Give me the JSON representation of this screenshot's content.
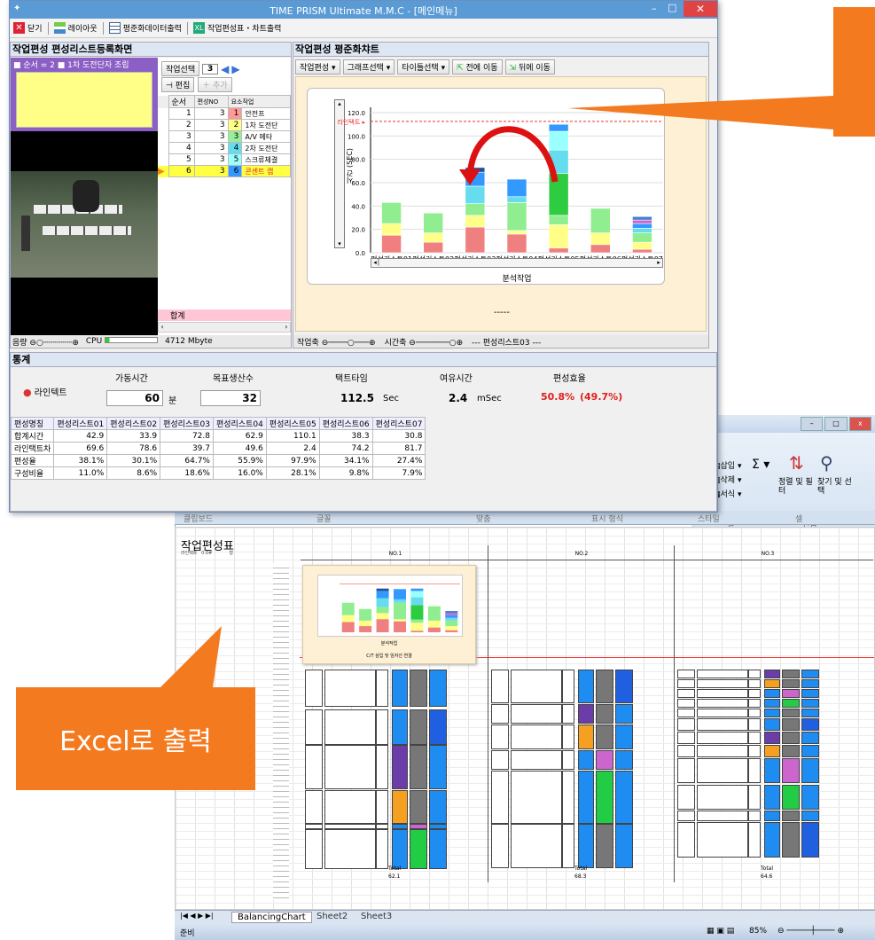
{
  "window": {
    "title": "TIME PRISM Ultimate M.M.C - [메인메뉴]"
  },
  "toolbar": {
    "close": "닫기",
    "layout": "레이아웃",
    "export_data": "평준화데이터출력",
    "export_chart": "작업편성표・차트출력"
  },
  "left_panel": {
    "title": "작업편성 편성리스트등록화면",
    "order_label": "■ 순서 = 2 ■ 1차 도전단자 조립",
    "select_label": "작업선택",
    "select_value": "3",
    "edit_label": "편집",
    "add_label": "추가",
    "table_headers": [
      "순서",
      "편성NO",
      "요소작업"
    ],
    "rows": [
      {
        "order": "1",
        "no": "3",
        "idx": "1",
        "name": "안전프",
        "color": "#ff9999"
      },
      {
        "order": "2",
        "no": "3",
        "idx": "2",
        "name": "1차 도전단",
        "color": "#ffff88"
      },
      {
        "order": "3",
        "no": "3",
        "idx": "3",
        "name": "A/V 메타",
        "color": "#99ee99"
      },
      {
        "order": "4",
        "no": "3",
        "idx": "4",
        "name": "2차 도전단",
        "color": "#66ddee"
      },
      {
        "order": "5",
        "no": "3",
        "idx": "5",
        "name": "스크류체결",
        "color": "#99ffff"
      },
      {
        "order": "6",
        "no": "3",
        "idx": "6",
        "name": "콘센트 캡",
        "color": "#3399ff"
      }
    ],
    "total_label": "합계",
    "volume_label": "음량",
    "cpu_label": "CPU",
    "memory": "4712 Mbyte"
  },
  "chart_panel": {
    "title": "작업편성 평준화챠트",
    "menu": [
      "작업편성",
      "그래프선택",
      "타이틀선택",
      "전에 이동",
      "뒤에 이동"
    ],
    "dashes": "-----",
    "work_axis": "작업축",
    "time_axis": "시간축",
    "list_label": "--- 편성리스트03 ---"
  },
  "stats": {
    "title": "통계",
    "line_tact": "라인텍트",
    "op_time_label": "가동시간",
    "op_time_value": "60",
    "op_time_unit": "분",
    "target_label": "목표생산수",
    "target_value": "32",
    "tact_label": "택트타임",
    "tact_value": "112.5",
    "tact_unit": "Sec",
    "margin_label": "여유시간",
    "margin_value": "2.4",
    "margin_unit": "mSec",
    "eff_label": "편성효율",
    "eff_value": "50.8%",
    "eff_alt": "(49.7%)",
    "table_headers": [
      "편성명칭",
      "편성리스트01",
      "편성리스트02",
      "편성리스트03",
      "편성리스트04",
      "편성리스트05",
      "편성리스트06",
      "편성리스트07"
    ],
    "table_rows": [
      [
        "합계시간",
        "42.9",
        "33.9",
        "72.8",
        "62.9",
        "110.1",
        "38.3",
        "30.8"
      ],
      [
        "라인택트차",
        "69.6",
        "78.6",
        "39.7",
        "49.6",
        "2.4",
        "74.2",
        "81.7"
      ],
      [
        "편성율",
        "38.1%",
        "30.1%",
        "64.7%",
        "55.9%",
        "97.9%",
        "34.1%",
        "27.4%"
      ],
      [
        "구성비율",
        "11.0%",
        "8.6%",
        "18.6%",
        "16.0%",
        "28.1%",
        "9.8%",
        "7.9%"
      ]
    ]
  },
  "chart_data": {
    "type": "bar",
    "stacked": true,
    "ylabel": "시간 (SEC)",
    "xlabel": "분석작업",
    "ylim": [
      0,
      120
    ],
    "yticks": [
      "0.0",
      "20.0",
      "40.0",
      "60.0",
      "80.0",
      "100.0",
      "120.0"
    ],
    "line_tact_label": "라인택트",
    "line_tact_value": 112.5,
    "categories": [
      "편성리스트01",
      "편성리스트02",
      "편성리스트03",
      "편성리스트04",
      "편성리스트05",
      "편성리스트06",
      "편성리스트07"
    ],
    "stacks": [
      [
        {
          "v": 15,
          "c": "#f08080"
        },
        {
          "v": 10,
          "c": "#ffff88"
        },
        {
          "v": 18,
          "c": "#90ee90"
        }
      ],
      [
        {
          "v": 9,
          "c": "#f08080"
        },
        {
          "v": 8,
          "c": "#ffff88"
        },
        {
          "v": 17,
          "c": "#90ee90"
        }
      ],
      [
        {
          "v": 22,
          "c": "#f08080"
        },
        {
          "v": 10,
          "c": "#ffff88"
        },
        {
          "v": 10,
          "c": "#90ee90"
        },
        {
          "v": 15,
          "c": "#66ddee"
        },
        {
          "v": 12,
          "c": "#3399ff"
        },
        {
          "v": 4,
          "c": "#1f4fa0"
        }
      ],
      [
        {
          "v": 16,
          "c": "#f08080"
        },
        {
          "v": 3,
          "c": "#ffff88"
        },
        {
          "v": 24,
          "c": "#90ee90"
        },
        {
          "v": 5,
          "c": "#66ddee"
        },
        {
          "v": 15,
          "c": "#3399ff"
        }
      ],
      [
        {
          "v": 4,
          "c": "#f08080"
        },
        {
          "v": 20,
          "c": "#ffff88"
        },
        {
          "v": 8,
          "c": "#90ee90"
        },
        {
          "v": 36,
          "c": "#2ecc40"
        },
        {
          "v": 20,
          "c": "#66ddee"
        },
        {
          "v": 16,
          "c": "#99ffff"
        },
        {
          "v": 6,
          "c": "#3399ff"
        }
      ],
      [
        {
          "v": 7,
          "c": "#f08080"
        },
        {
          "v": 10,
          "c": "#ffff88"
        },
        {
          "v": 21,
          "c": "#90ee90"
        }
      ],
      [
        {
          "v": 3,
          "c": "#f08080"
        },
        {
          "v": 6,
          "c": "#ffff88"
        },
        {
          "v": 8,
          "c": "#90ee90"
        },
        {
          "v": 4,
          "c": "#66ddee"
        },
        {
          "v": 4,
          "c": "#3399ff"
        },
        {
          "v": 3,
          "c": "#cc66cc"
        },
        {
          "v": 3,
          "c": "#4a7dd0"
        }
      ]
    ]
  },
  "excel": {
    "ribbon": {
      "insert": "삽입",
      "delete": "삭제",
      "format": "서식",
      "sort": "정렬 및 필터",
      "find": "찾기 및 선택",
      "edit_group": "편집",
      "cell_group": "셀"
    },
    "groupbar": [
      "클립보드",
      "글꼴",
      "맞춤",
      "표시 형식",
      "스타일",
      "셀"
    ],
    "sheet_title": "작업편성표",
    "col_headers": [
      "NO.1",
      "NO.2",
      "NO.3"
    ],
    "totals": [
      "62.1",
      "68.3",
      "64.6"
    ],
    "total_label": "Total",
    "mini_chart_caption": "C/T 삼입 및 임자선 연결",
    "mini_chart_label": "분석작업",
    "tabs": [
      "BalancingChart",
      "Sheet2",
      "Sheet3"
    ],
    "status": "준비",
    "zoom": "85%"
  },
  "callouts": {
    "excel_output": "Excel로 출력"
  }
}
